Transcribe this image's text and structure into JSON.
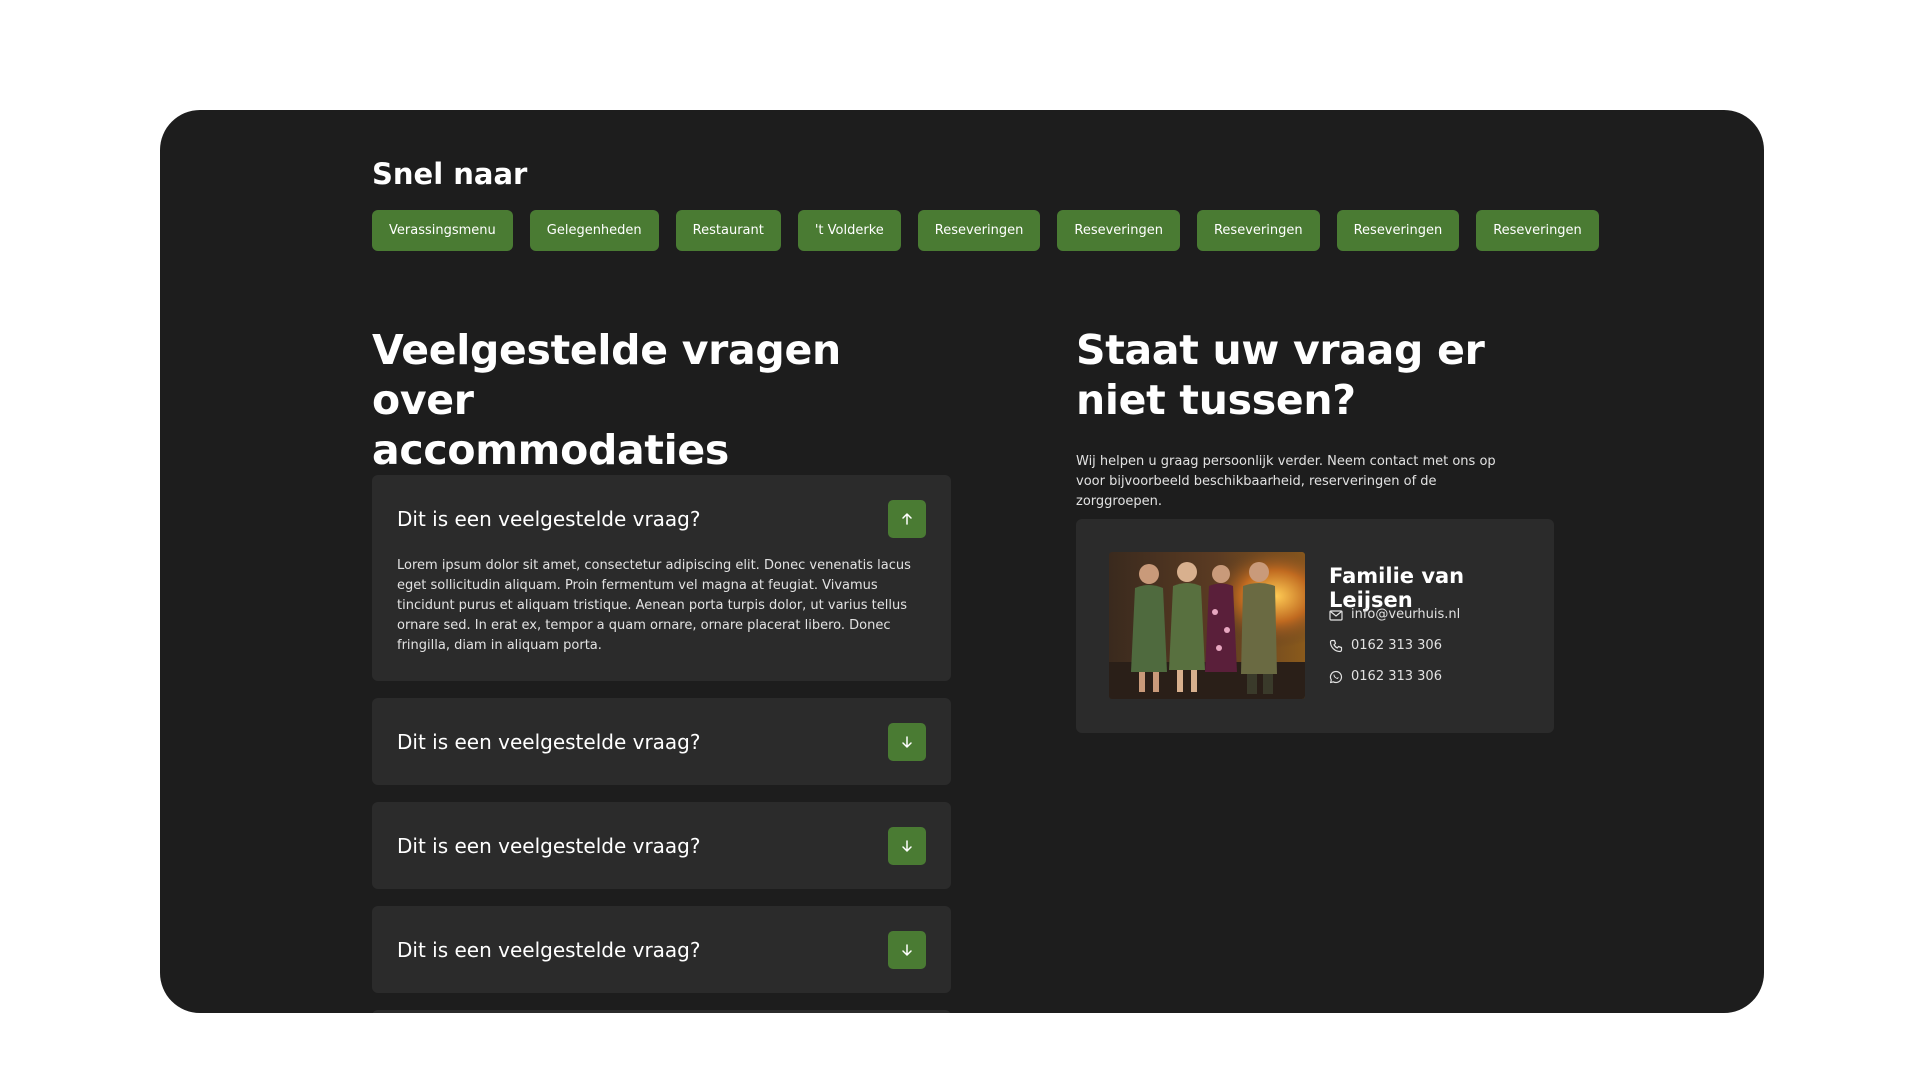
{
  "quick_nav": {
    "title": "Snel naar",
    "links": [
      "Verassingsmenu",
      "Gelegenheden",
      "Restaurant",
      "'t Volderke",
      "Reseveringen",
      "Reseveringen",
      "Reseveringen",
      "Reseveringen",
      "Reseveringen"
    ]
  },
  "faq": {
    "title_line1": "Veelgestelde vragen over",
    "title_line2": "accommodaties",
    "items": [
      {
        "question": "Dit is een veelgestelde vraag?",
        "answer": "Lorem ipsum dolor sit amet, consectetur adipiscing elit. Donec venenatis lacus eget sollicitudin aliquam. Proin fermentum vel magna at feugiat. Vivamus tincidunt purus et aliquam tristique. Aenean porta turpis dolor, ut varius tellus ornare sed. In erat ex, tempor a quam ornare, ornare placerat libero. Donec fringilla, diam in aliquam porta.",
        "expanded": true
      },
      {
        "question": "Dit is een veelgestelde vraag?",
        "expanded": false
      },
      {
        "question": "Dit is een veelgestelde vraag?",
        "expanded": false
      },
      {
        "question": "Dit is een veelgestelde vraag?",
        "expanded": false
      },
      {
        "question": "",
        "expanded": false
      }
    ]
  },
  "contact": {
    "title_line1": "Staat uw vraag er",
    "title_line2": "niet tussen?",
    "text": "Wij helpen u graag persoonlijk verder. Neem contact met ons op voor bijvoorbeeld beschikbaarheid, reserveringen of de zorggroepen.",
    "name": "Familie van Leijsen",
    "email": "info@veurhuis.nl",
    "phone": "0162 313 306",
    "whatsapp": "0162 313 306"
  },
  "colors": {
    "panel_bg": "#1d1d1d",
    "card_bg": "#2b2b2b",
    "accent_green": "#4a7b33"
  }
}
